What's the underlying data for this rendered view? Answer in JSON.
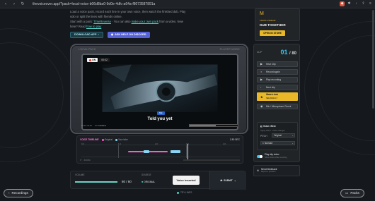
{
  "browser": {
    "url": "thevoiceover.app/?pack=local-voice-b06d8ba0-9d0e-4dfc-a64a-f8073587891a"
  },
  "intro": {
    "line1": "Load a voice pack, record each line in your own voice, then watch the finished dub. Play",
    "line2": "solo or split the lines with friends online.",
    "line3a": "Start with a pack: ",
    "line3link1": "TimeReverse",
    "line3b": " · You can also ",
    "line3link2": "make your own pack",
    "line3c": " from a video. New",
    "line4a": "here? Read ",
    "line4link": "how to play",
    "download_label": "DOWNLOAD APP",
    "discord_label": "ASK HELP ON DISCORD"
  },
  "device": {
    "left_label": "LOCAL PACK",
    "right_label": "PLAYER MODE",
    "rec_chip": "ON",
    "rec_time": "00:02",
    "subtitle_tag": "ME",
    "subtitle": "Told you yet",
    "foot_left": "PLAY CLIP",
    "foot_mid": "AI DUBBED",
    "progress": 0.55
  },
  "timeline": {
    "title": "VOICE TIMELINE",
    "legend1": "Original",
    "legend2": "Your take",
    "time": "2.80",
    "time_unit": "SEC",
    "ticks": [
      "0.0",
      "1.0",
      "2.0",
      "3.0",
      "4.0"
    ],
    "foot": "ZOOM"
  },
  "controls": {
    "volume_label": "VOLUME",
    "volume_value": "80 / 80",
    "volume_level": 1.0,
    "source_label": "SOURCE",
    "source_value": "ORIGINAL",
    "voice_button": "Voice inserted",
    "submit_label": "SUBMIT",
    "note": "TRY LINES"
  },
  "promo": {
    "logo": "M",
    "small": "FROM LOREAM",
    "title": "DUB TOGETHER",
    "button": "OPEN IN STORE"
  },
  "panel": {
    "clip_label": "CLIP",
    "current": "01",
    "total": "80",
    "rows": [
      {
        "icon": "play-icon",
        "glyph": "▶",
        "label": "Hear Clip"
      },
      {
        "icon": "record-icon",
        "glyph": "●",
        "label": "Record again"
      },
      {
        "icon": "play-recording-icon",
        "glyph": "▶",
        "label": "Play recording"
      },
      {
        "icon": "next-icon",
        "glyph": "›",
        "label": "Next clip"
      },
      {
        "icon": "star-icon",
        "glyph": "★",
        "label": "Watch dub",
        "sub": "SEE RESULT",
        "active": true
      },
      {
        "icon": "mic-icon",
        "glyph": "◉",
        "label": "Mic / Microphone Check"
      }
    ],
    "voice_effect_title": "Voice effect",
    "voice_effect_sub": "Apply effect · Voice changer",
    "pitch_label": "PITCH",
    "pitch_value": "Original",
    "preset_value": "Narrator",
    "play_clip_title": "Play clip video",
    "play_clip_sub": "Show video while recording",
    "feedback_title": "Send feedback",
    "feedback_sub": "Report a problem"
  },
  "pills": {
    "recordings": "Recordings",
    "packs": "Packs"
  }
}
